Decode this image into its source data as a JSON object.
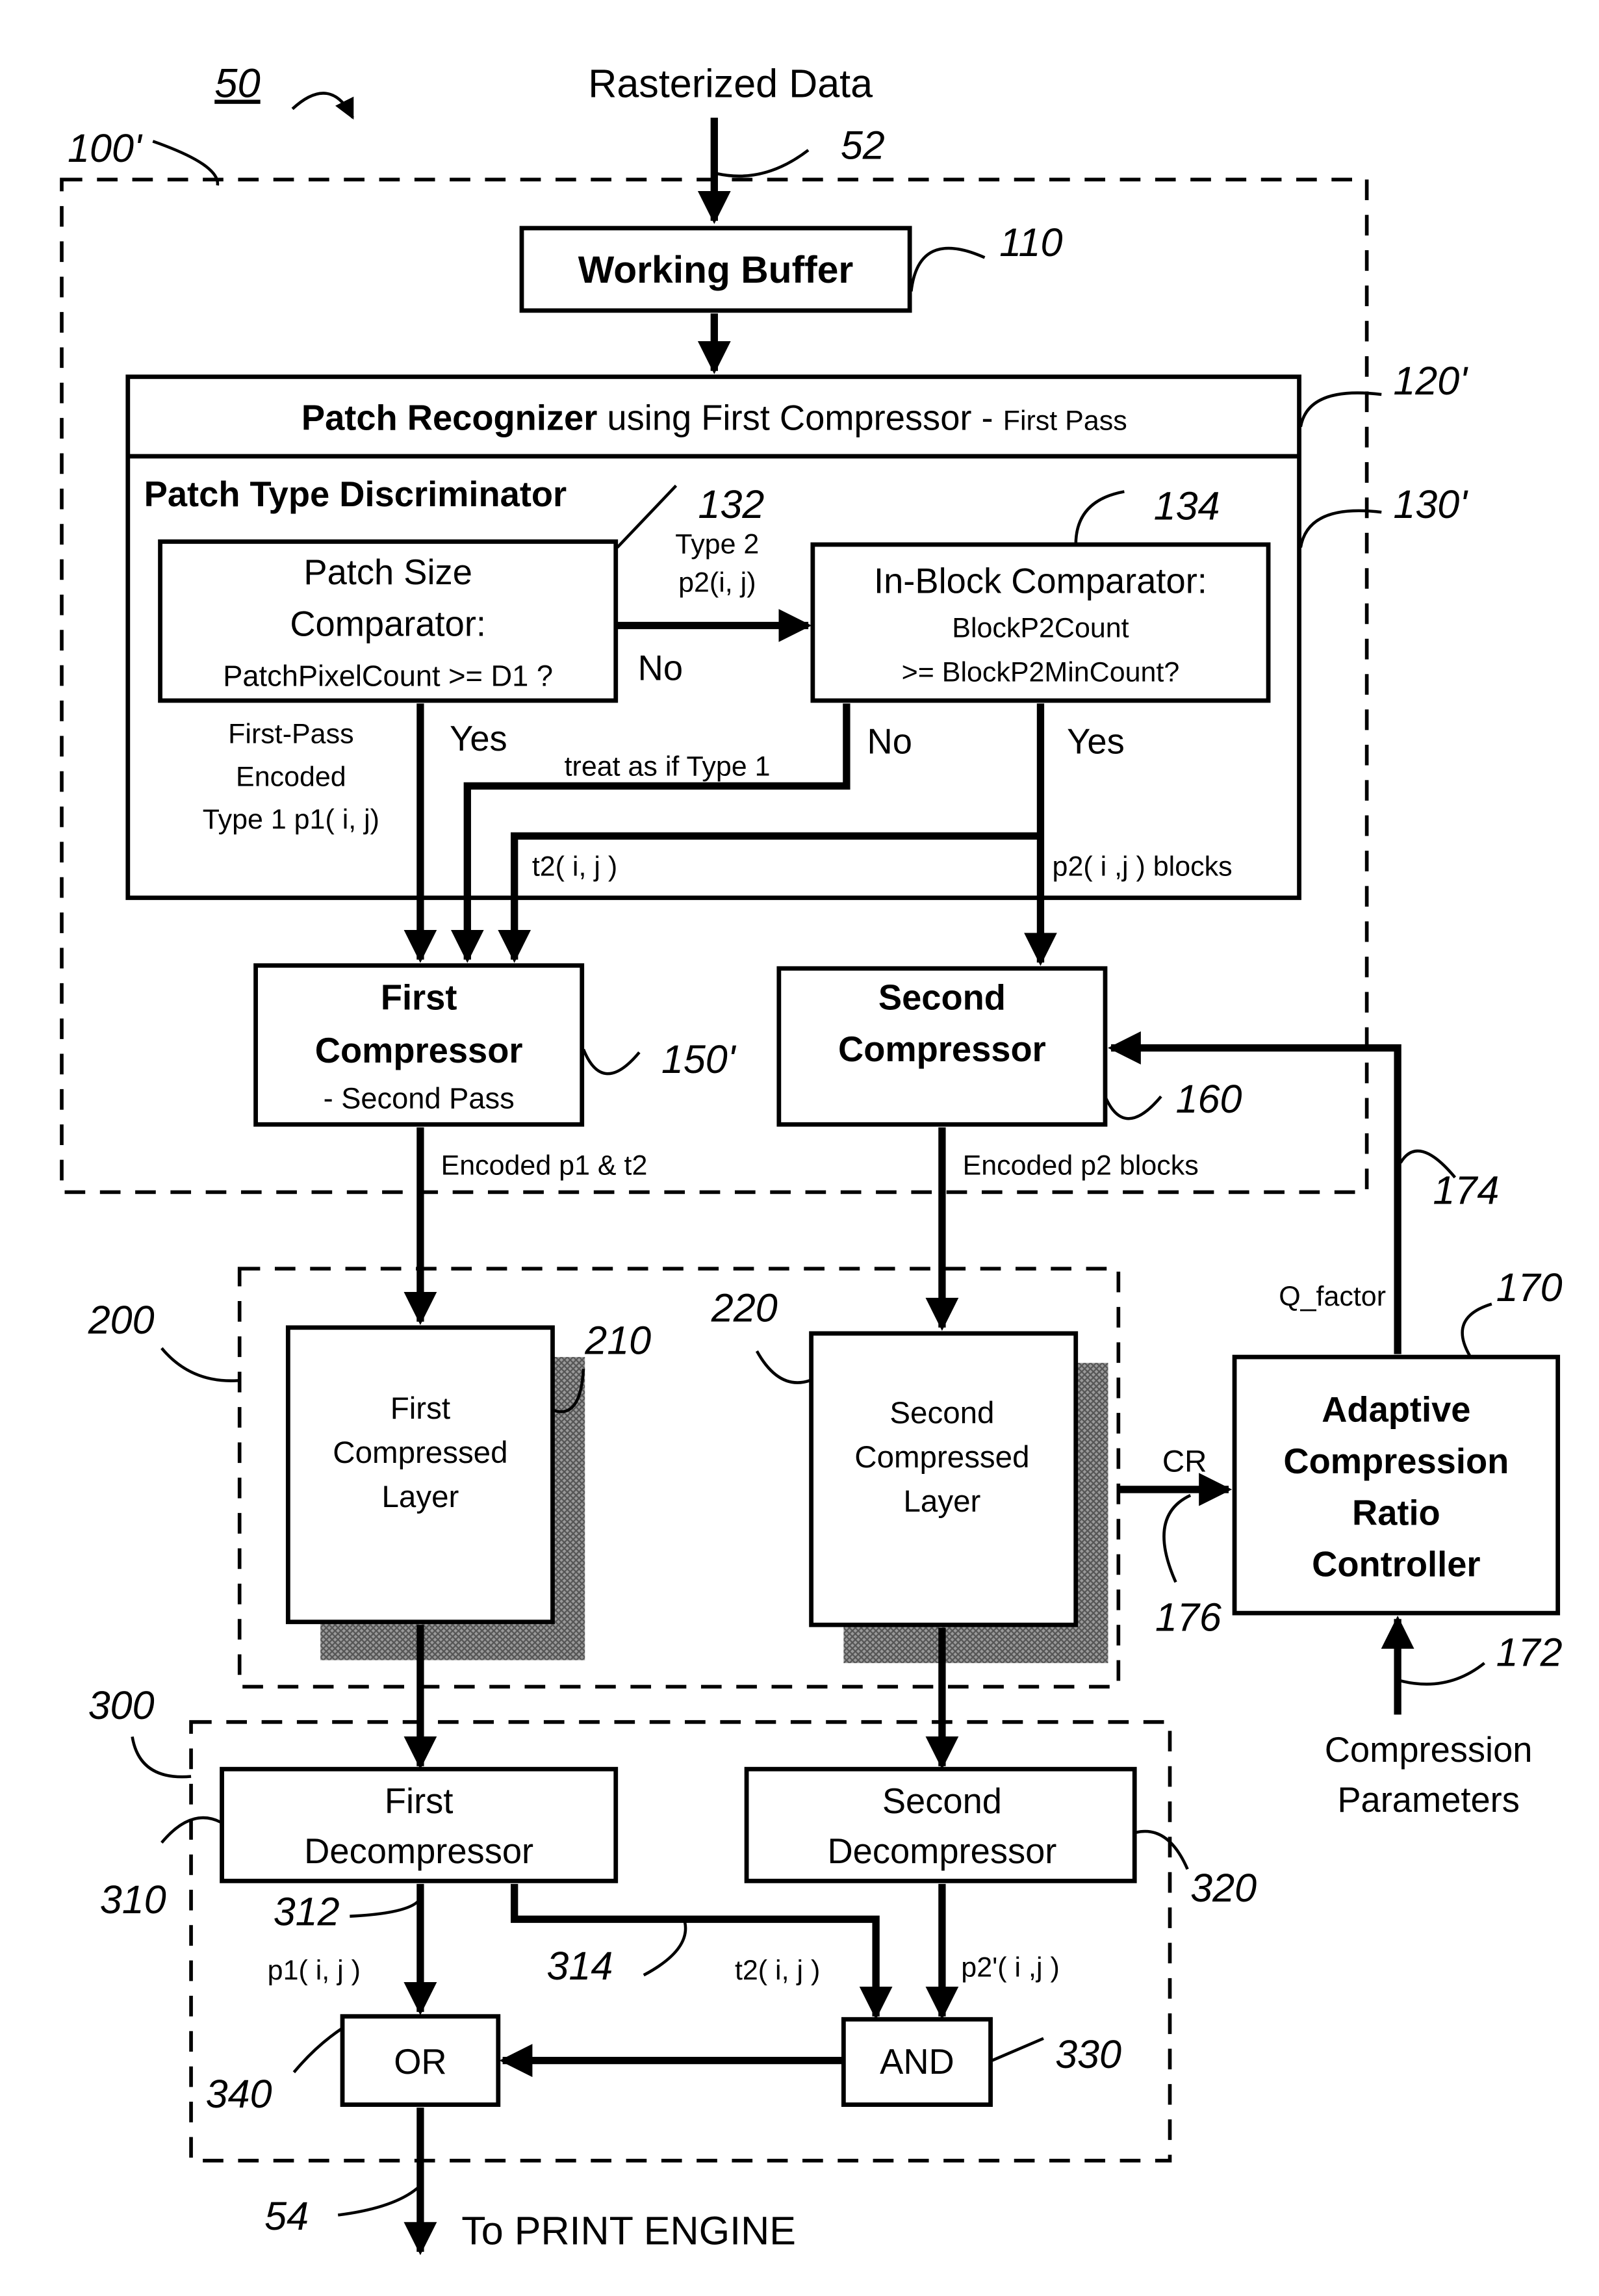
{
  "figure": {
    "number": "50",
    "input_label": "Rasterized Data",
    "output_label": "To PRINT ENGINE"
  },
  "refs": {
    "r50": "50",
    "r100": "100'",
    "r52": "52",
    "r110": "110",
    "r120": "120'",
    "r130": "130'",
    "r132": "132",
    "r134": "134",
    "r150": "150'",
    "r160": "160",
    "r174": "174",
    "r170": "170",
    "r176": "176",
    "r172": "172",
    "r200": "200",
    "r210": "210",
    "r220": "220",
    "r300": "300",
    "r310": "310",
    "r312": "312",
    "r314": "314",
    "r320": "320",
    "r330": "330",
    "r340": "340",
    "r54": "54"
  },
  "blocks": {
    "working_buffer": "Working Buffer",
    "patch_recognizer": {
      "title_bold": "Patch Recognizer",
      "title_rest": " using First Compressor - ",
      "title_small": "First Pass"
    },
    "patch_type_discriminator": "Patch Type Discriminator",
    "patch_size_comparator": {
      "line1": "Patch Size",
      "line2": "Comparator:",
      "line3": "PatchPixelCount >= D1 ?"
    },
    "in_block_comparator": {
      "line1": "In-Block Comparator:",
      "line2": "BlockP2Count",
      "line3": ">= BlockP2MinCount?"
    },
    "first_compressor": {
      "line1": "First",
      "line2": "Compressor",
      "line3": "- Second Pass"
    },
    "second_compressor": {
      "line1": "Second",
      "line2": "Compressor"
    },
    "first_compressed_layer": [
      "First",
      "Compressed",
      "Layer"
    ],
    "second_compressed_layer": [
      "Second",
      "Compressed",
      "Layer"
    ],
    "adaptive_controller": [
      "Adaptive",
      "Compression",
      "Ratio",
      "Controller"
    ],
    "first_decompressor": [
      "First",
      "Decompressor"
    ],
    "second_decompressor": [
      "Second",
      "Decompressor"
    ],
    "or_gate": "OR",
    "and_gate": "AND",
    "compression_parameters": [
      "Compression",
      "Parameters"
    ]
  },
  "edge_labels": {
    "type2_line1": "Type 2",
    "type2_line2": "p2(i, j)",
    "no1": "No",
    "yes1": "Yes",
    "no2": "No",
    "yes2": "Yes",
    "first_pass_encoded": [
      "First-Pass",
      "Encoded",
      "Type 1 p1( i, j)"
    ],
    "treat_as_type1": "treat as if Type 1",
    "t2_upper": "t2( i, j )",
    "p2_blocks": "p2( i ,j ) blocks",
    "encoded_p1_t2": "Encoded p1 & t2",
    "encoded_p2_blocks": "Encoded p2 blocks",
    "q_factor": "Q_factor",
    "cr": "CR",
    "p1_lower": "p1( i, j )",
    "t2_lower": "t2( i, j )",
    "p2prime_lower": "p2'( i ,j )"
  }
}
